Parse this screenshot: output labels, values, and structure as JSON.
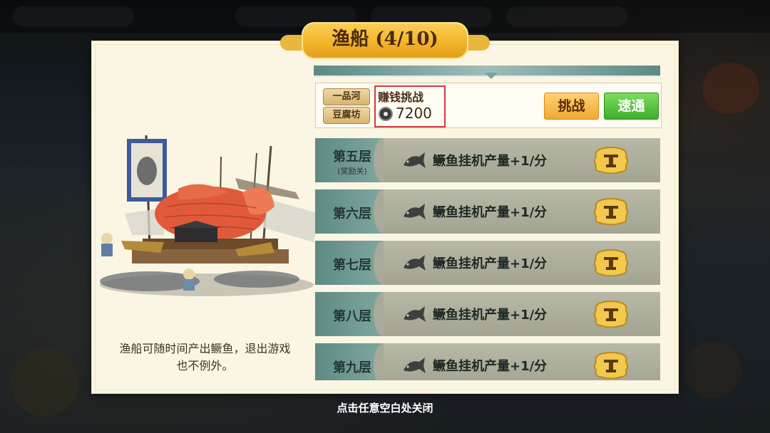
{
  "title": "渔船 (4/10)",
  "description": "渔船可随时间产出鳜鱼，退出游戏也不例外。",
  "close_hint": "点击任意空白处关闭",
  "challenge": {
    "tag_top": "一品河",
    "tag_bottom": "豆腐坊",
    "label": "赚钱挑战",
    "amount": "7200",
    "challenge_button": "挑战",
    "sweep_button": "速通"
  },
  "floors": [
    {
      "name": "第五层",
      "sub": "(奖励关)",
      "reward": "鳜鱼挂机产量+1/分"
    },
    {
      "name": "第六层",
      "sub": "",
      "reward": "鳜鱼挂机产量+1/分"
    },
    {
      "name": "第七层",
      "sub": "",
      "reward": "鳜鱼挂机产量+1/分"
    },
    {
      "name": "第八层",
      "sub": "",
      "reward": "鳜鱼挂机产量+1/分"
    },
    {
      "name": "第九层",
      "sub": "",
      "reward": "鳜鱼挂机产量+1/分"
    }
  ],
  "icons": {
    "reward_icon": "fish-icon",
    "claim_icon": "chest-icon",
    "currency_icon": "coin-icon"
  },
  "colors": {
    "title_gold": "#f3b52c",
    "challenge_button": "#f1a832",
    "sweep_button": "#3fae2b",
    "floor_cap": "#5f8a84",
    "highlight_border": "#d23b3b"
  }
}
